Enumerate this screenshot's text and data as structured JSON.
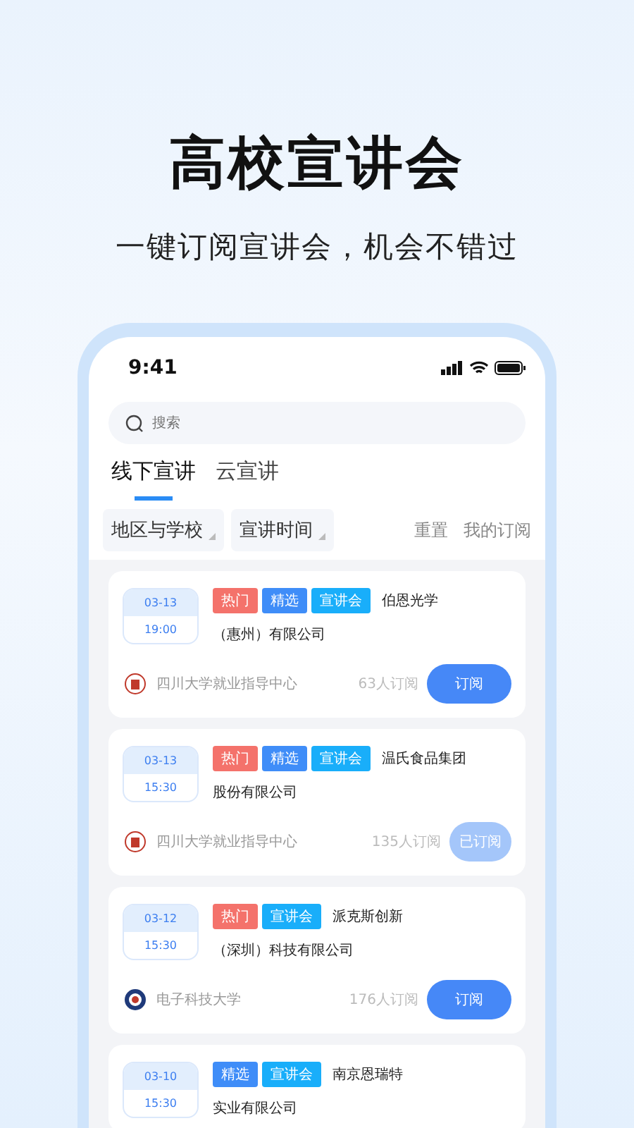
{
  "headline": "高校宣讲会",
  "subtitle": "一键订阅宣讲会，机会不错过",
  "status_bar": {
    "time": "9:41"
  },
  "search": {
    "placeholder": "搜索"
  },
  "tabs": [
    {
      "label": "线下宣讲",
      "selected": true
    },
    {
      "label": "云宣讲",
      "selected": false
    }
  ],
  "filters": [
    {
      "label": "地区与学校"
    },
    {
      "label": "宣讲时间"
    }
  ],
  "actions": [
    "重置",
    "我的订阅"
  ],
  "events": [
    {
      "date": "03-13",
      "time": "19:00",
      "tags": [
        {
          "label": "热门",
          "kind": "hot"
        },
        {
          "label": "精选",
          "kind": "featured"
        },
        {
          "label": "宣讲会",
          "kind": "talk"
        }
      ],
      "company_line1": "伯恩光学",
      "company_line2": "（惠州）有限公司",
      "host": "四川大学就业指导中心",
      "host_logo": {
        "kind": "seal"
      },
      "subscribers": "63人订阅",
      "button": "订阅",
      "subscribed": false
    },
    {
      "date": "03-13",
      "time": "15:30",
      "tags": [
        {
          "label": "热门",
          "kind": "hot"
        },
        {
          "label": "精选",
          "kind": "featured"
        },
        {
          "label": "宣讲会",
          "kind": "talk"
        }
      ],
      "company_line1": "温氏食品集团",
      "company_line2": "股份有限公司",
      "host": "四川大学就业指导中心",
      "host_logo": {
        "kind": "seal"
      },
      "subscribers": "135人订阅",
      "button": "已订阅",
      "subscribed": true
    },
    {
      "date": "03-12",
      "time": "15:30",
      "tags": [
        {
          "label": "热门",
          "kind": "hot"
        },
        {
          "label": "宣讲会",
          "kind": "talk"
        }
      ],
      "company_line1": "派克斯创新",
      "company_line2": "（深圳）科技有限公司",
      "host": "电子科技大学",
      "host_logo": {
        "kind": "emblem"
      },
      "subscribers": "176人订阅",
      "button": "订阅",
      "subscribed": false
    },
    {
      "date": "03-10",
      "time": "15:30",
      "tags": [
        {
          "label": "精选",
          "kind": "featured"
        },
        {
          "label": "宣讲会",
          "kind": "talk"
        }
      ],
      "company_line1": "南京恩瑞特",
      "company_line2": "实业有限公司"
    }
  ]
}
